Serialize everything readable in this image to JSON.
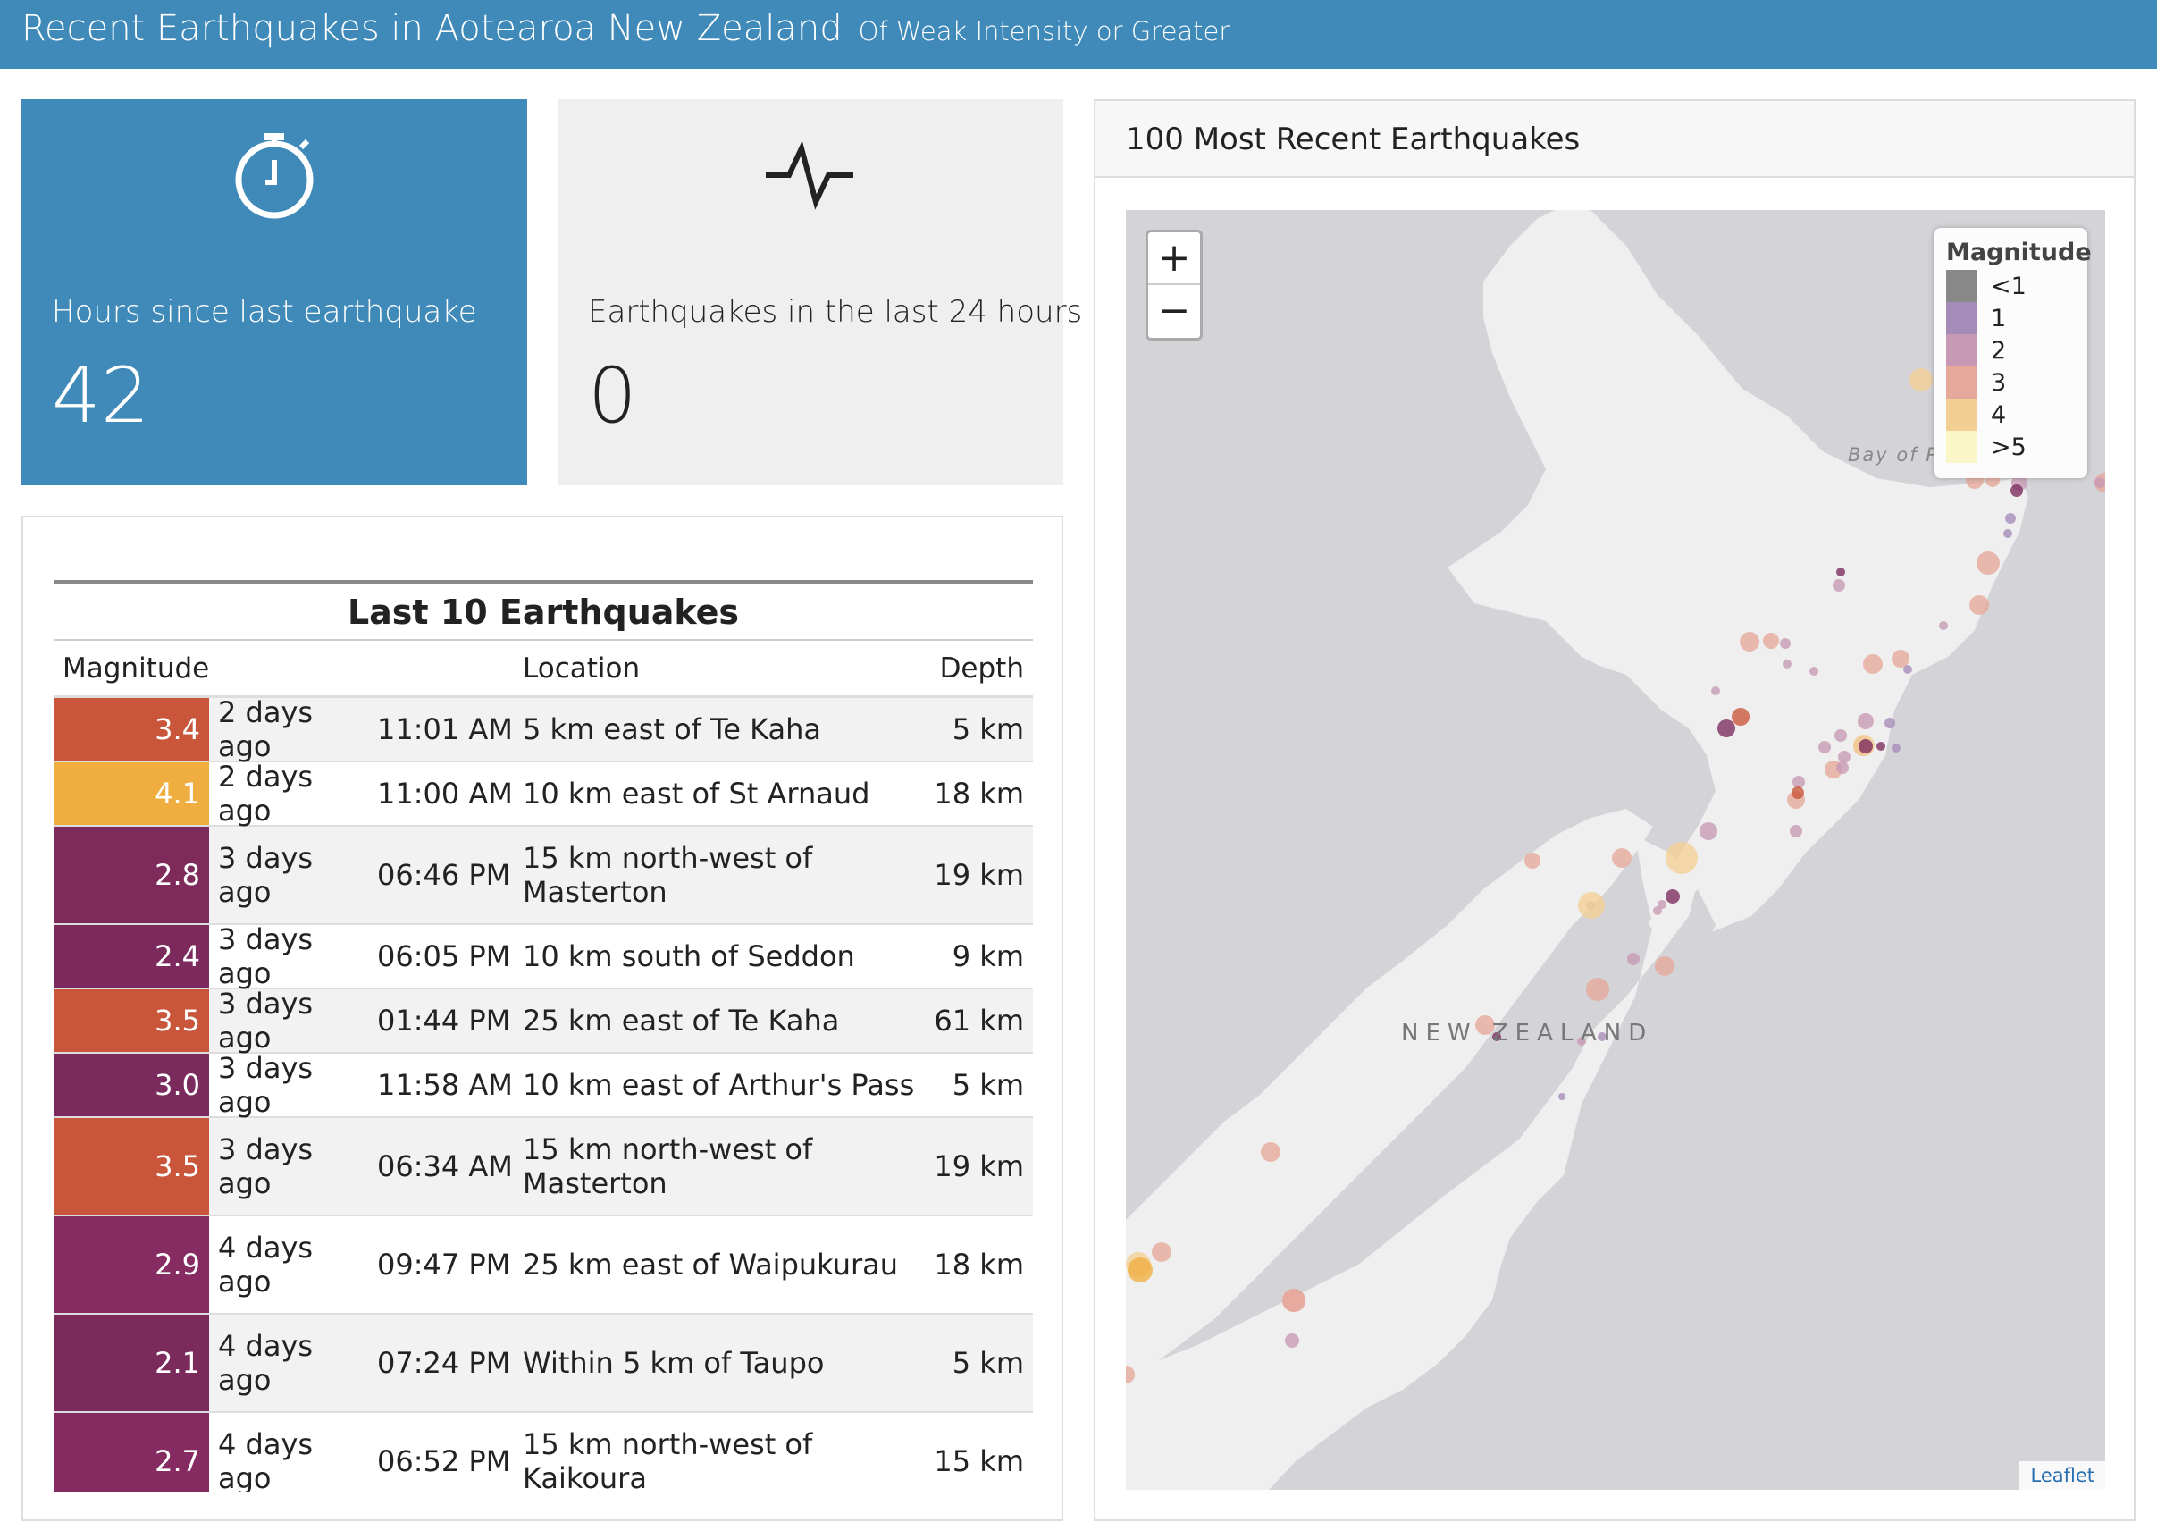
{
  "header": {
    "title": "Recent Earthquakes in Aotearoa New Zealand",
    "subtitle": "Of Weak Intensity or Greater"
  },
  "box_hours": {
    "caption": "Hours since last earthquake",
    "value": "42",
    "icon": "stopwatch-icon"
  },
  "box_24h": {
    "caption": "Earthquakes in the last 24 hours",
    "value": "0",
    "icon": "pulse-icon"
  },
  "table": {
    "title": "Last 10 Earthquakes",
    "headers": {
      "magnitude": "Magnitude",
      "location": "Location",
      "depth": "Depth"
    },
    "rows": [
      {
        "mag": "3.4",
        "color": "#c9553a",
        "day": "2 days ago",
        "time": "11:01 AM",
        "location": "5 km east of Te Kaha",
        "depth": "5 km"
      },
      {
        "mag": "4.1",
        "color": "#efae3f",
        "day": "2 days ago",
        "time": "11:00 AM",
        "location": "10 km east of St Arnaud",
        "depth": "18 km"
      },
      {
        "mag": "2.8",
        "color": "#7e2b5b",
        "day": "3 days ago",
        "time": "06:46 PM",
        "location": "15 km north-west of Masterton",
        "depth": "19 km"
      },
      {
        "mag": "2.4",
        "color": "#7c2a5e",
        "day": "3 days ago",
        "time": "06:05 PM",
        "location": "10 km south of Seddon",
        "depth": "9 km"
      },
      {
        "mag": "3.5",
        "color": "#c9553a",
        "day": "3 days ago",
        "time": "01:44 PM",
        "location": "25 km east of Te Kaha",
        "depth": "61 km"
      },
      {
        "mag": "3.0",
        "color": "#7a2a5c",
        "day": "3 days ago",
        "time": "11:58 AM",
        "location": "10 km east of Arthur's Pass",
        "depth": "5 km"
      },
      {
        "mag": "3.5",
        "color": "#c9553a",
        "day": "3 days ago",
        "time": "06:34 AM",
        "location": "15 km north-west of Masterton",
        "depth": "19 km"
      },
      {
        "mag": "2.9",
        "color": "#872c62",
        "day": "4 days ago",
        "time": "09:47 PM",
        "location": "25 km east of Waipukurau",
        "depth": "18 km"
      },
      {
        "mag": "2.1",
        "color": "#7b2a5c",
        "day": "4 days ago",
        "time": "07:24 PM",
        "location": "Within 5 km of Taupo",
        "depth": "5 km"
      },
      {
        "mag": "2.7",
        "color": "#852b62",
        "day": "4 days ago",
        "time": "06:52 PM",
        "location": "15 km north-west of Kaikoura",
        "depth": "15 km"
      }
    ]
  },
  "map": {
    "title": "100 Most Recent Earthquakes",
    "zoom_in": "+",
    "zoom_out": "−",
    "country_label": "NEW ZEALAND",
    "bay_label": "Bay of P",
    "attribution": "Leaflet",
    "legend": {
      "title": "Magnitude",
      "items": [
        {
          "label": "<1",
          "color": "#888888"
        },
        {
          "label": "1",
          "color": "#a58bb8"
        },
        {
          "label": "2",
          "color": "#c799b4"
        },
        {
          "label": "3",
          "color": "#e6a89a"
        },
        {
          "label": "4",
          "color": "#f4cf94"
        },
        {
          "label": ">5",
          "color": "#fbf6c8"
        }
      ]
    }
  }
}
